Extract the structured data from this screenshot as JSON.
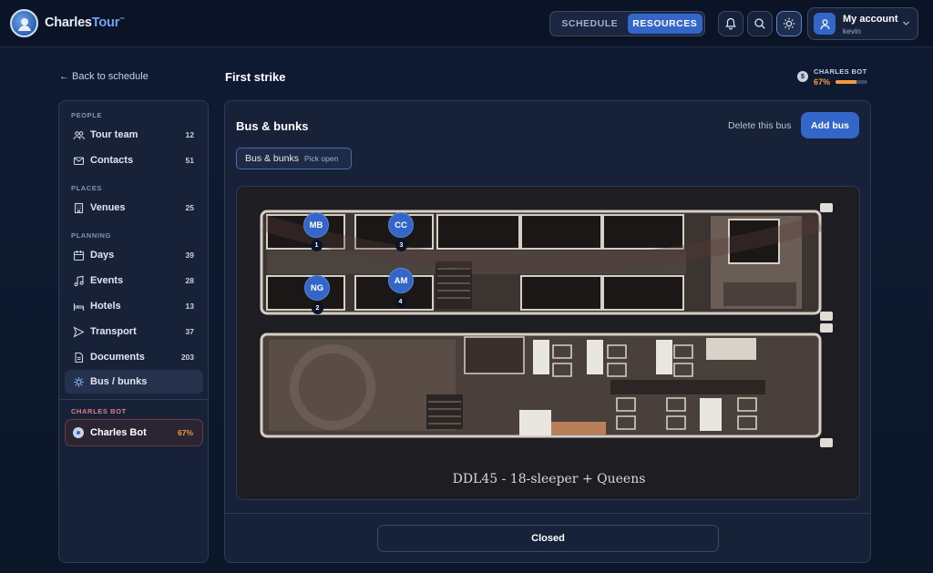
{
  "brand": {
    "name_a": "Charles",
    "name_b": "Tour",
    "tm": "™"
  },
  "topnav": {
    "tabs": [
      {
        "label": "SCHEDULE",
        "active": false
      },
      {
        "label": "RESOURCES",
        "active": true
      }
    ]
  },
  "account": {
    "label": "My account",
    "user": "kevin"
  },
  "header": {
    "back": "← Back to schedule",
    "title": "First strike"
  },
  "bot_status": {
    "label": "CHARLES BOT",
    "percent_text": "67%",
    "progress": 0.67
  },
  "sidebar": {
    "sections": [
      "PEOPLE",
      "PLACES",
      "PLANNING",
      "CHARLES BOT"
    ],
    "items": [
      {
        "label": "Tour team",
        "count": "12",
        "icon": "team-icon"
      },
      {
        "label": "Contacts",
        "count": "51",
        "icon": "mail-icon"
      },
      {
        "label": "Venues",
        "count": "25",
        "icon": "building-icon"
      },
      {
        "label": "Days",
        "count": "39",
        "icon": "calendar-icon"
      },
      {
        "label": "Events",
        "count": "28",
        "icon": "music-icon"
      },
      {
        "label": "Hotels",
        "count": "13",
        "icon": "bed-icon"
      },
      {
        "label": "Transport",
        "count": "37",
        "icon": "send-icon"
      },
      {
        "label": "Documents",
        "count": "203",
        "icon": "document-icon"
      },
      {
        "label": "Bus / bunks",
        "count": "",
        "icon": "bus-icon"
      }
    ],
    "bot": {
      "label": "Charles Bot",
      "percent": "67%"
    }
  },
  "main": {
    "title": "Bus & bunks",
    "delete_label": "Delete this bus",
    "add_label": "Add bus",
    "chip": {
      "label": "Bus & bunks",
      "sub": "Pick open"
    },
    "plan_caption": "DDL45 - 18-sleeper + Queens",
    "bunks": [
      {
        "initials": "MB",
        "num": "1"
      },
      {
        "initials": "CC",
        "num": "3"
      },
      {
        "initials": "NG",
        "num": "2"
      },
      {
        "initials": "AM",
        "num": "4"
      }
    ],
    "closed_label": "Closed"
  },
  "colors": {
    "accent": "#3466c9",
    "bot_orange": "#f49a3c",
    "bg": "#0f1b33",
    "panel": "#172239"
  }
}
